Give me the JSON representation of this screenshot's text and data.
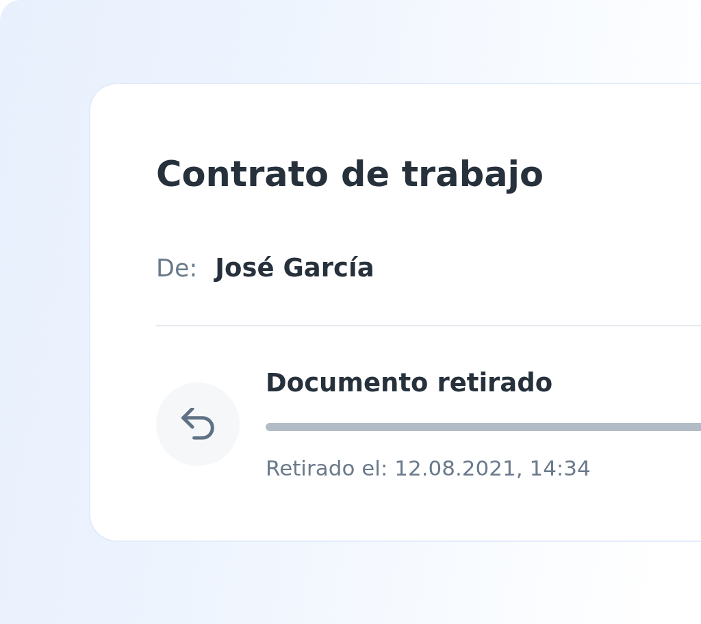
{
  "document": {
    "title": "Contrato de trabajo",
    "sender_label": "De:",
    "sender_name": "José García"
  },
  "status": {
    "kind": "withdrawn",
    "title": "Documento retirado",
    "detail": "Retirado el: 12.08.2021, 14:34"
  }
}
